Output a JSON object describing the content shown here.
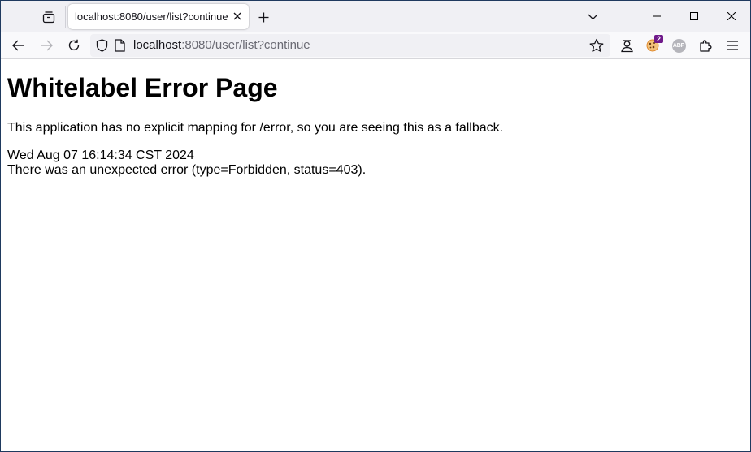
{
  "browser": {
    "tab_title": "localhost:8080/user/list?continue",
    "url_host": "localhost",
    "url_rest": ":8080/user/list?continue",
    "extension_badge_count": "2",
    "abp_label": "ABP"
  },
  "icons": {
    "tab_overview": "tab-overview-icon",
    "tab_close": "close-icon",
    "new_tab": "plus-icon",
    "tab_list": "chevron-down-icon",
    "minimize": "minimize-icon",
    "maximize": "maximize-icon",
    "close": "close-icon",
    "back": "back-arrow-icon",
    "forward": "forward-arrow-icon",
    "reload": "reload-icon",
    "shield": "shield-icon",
    "page": "page-icon",
    "bookmark": "star-icon",
    "account": "account-icon",
    "extension_cookie": "cookie-icon",
    "extension_abp": "adblock-icon",
    "extensions": "puzzle-icon",
    "menu": "hamburger-menu-icon"
  },
  "page": {
    "heading": "Whitelabel Error Page",
    "message": "This application has no explicit mapping for /error, so you are seeing this as a fallback.",
    "timestamp": "Wed Aug 07 16:14:34 CST 2024",
    "error_detail": "There was an unexpected error (type=Forbidden, status=403)."
  },
  "colors": {
    "window_border": "#1f3a5f",
    "tabstrip_bg": "#f0f0f4",
    "navbar_bg": "#f9f9fb",
    "badge_bg": "#6f1a8a"
  }
}
